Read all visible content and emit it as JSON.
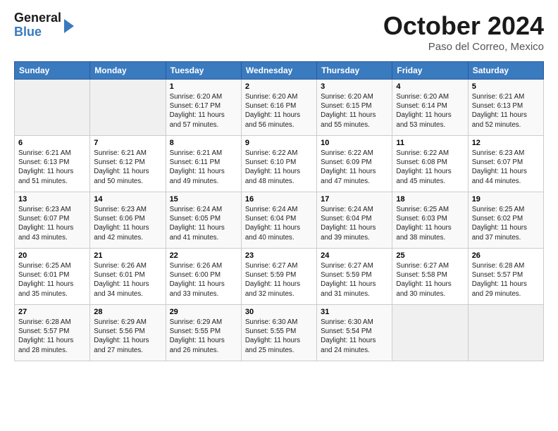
{
  "logo": {
    "line1": "General",
    "line2": "Blue"
  },
  "title": "October 2024",
  "subtitle": "Paso del Correo, Mexico",
  "days_of_week": [
    "Sunday",
    "Monday",
    "Tuesday",
    "Wednesday",
    "Thursday",
    "Friday",
    "Saturday"
  ],
  "weeks": [
    [
      {
        "day": "",
        "info": ""
      },
      {
        "day": "",
        "info": ""
      },
      {
        "day": "1",
        "info": "Sunrise: 6:20 AM\nSunset: 6:17 PM\nDaylight: 11 hours and 57 minutes."
      },
      {
        "day": "2",
        "info": "Sunrise: 6:20 AM\nSunset: 6:16 PM\nDaylight: 11 hours and 56 minutes."
      },
      {
        "day": "3",
        "info": "Sunrise: 6:20 AM\nSunset: 6:15 PM\nDaylight: 11 hours and 55 minutes."
      },
      {
        "day": "4",
        "info": "Sunrise: 6:20 AM\nSunset: 6:14 PM\nDaylight: 11 hours and 53 minutes."
      },
      {
        "day": "5",
        "info": "Sunrise: 6:21 AM\nSunset: 6:13 PM\nDaylight: 11 hours and 52 minutes."
      }
    ],
    [
      {
        "day": "6",
        "info": "Sunrise: 6:21 AM\nSunset: 6:13 PM\nDaylight: 11 hours and 51 minutes."
      },
      {
        "day": "7",
        "info": "Sunrise: 6:21 AM\nSunset: 6:12 PM\nDaylight: 11 hours and 50 minutes."
      },
      {
        "day": "8",
        "info": "Sunrise: 6:21 AM\nSunset: 6:11 PM\nDaylight: 11 hours and 49 minutes."
      },
      {
        "day": "9",
        "info": "Sunrise: 6:22 AM\nSunset: 6:10 PM\nDaylight: 11 hours and 48 minutes."
      },
      {
        "day": "10",
        "info": "Sunrise: 6:22 AM\nSunset: 6:09 PM\nDaylight: 11 hours and 47 minutes."
      },
      {
        "day": "11",
        "info": "Sunrise: 6:22 AM\nSunset: 6:08 PM\nDaylight: 11 hours and 45 minutes."
      },
      {
        "day": "12",
        "info": "Sunrise: 6:23 AM\nSunset: 6:07 PM\nDaylight: 11 hours and 44 minutes."
      }
    ],
    [
      {
        "day": "13",
        "info": "Sunrise: 6:23 AM\nSunset: 6:07 PM\nDaylight: 11 hours and 43 minutes."
      },
      {
        "day": "14",
        "info": "Sunrise: 6:23 AM\nSunset: 6:06 PM\nDaylight: 11 hours and 42 minutes."
      },
      {
        "day": "15",
        "info": "Sunrise: 6:24 AM\nSunset: 6:05 PM\nDaylight: 11 hours and 41 minutes."
      },
      {
        "day": "16",
        "info": "Sunrise: 6:24 AM\nSunset: 6:04 PM\nDaylight: 11 hours and 40 minutes."
      },
      {
        "day": "17",
        "info": "Sunrise: 6:24 AM\nSunset: 6:04 PM\nDaylight: 11 hours and 39 minutes."
      },
      {
        "day": "18",
        "info": "Sunrise: 6:25 AM\nSunset: 6:03 PM\nDaylight: 11 hours and 38 minutes."
      },
      {
        "day": "19",
        "info": "Sunrise: 6:25 AM\nSunset: 6:02 PM\nDaylight: 11 hours and 37 minutes."
      }
    ],
    [
      {
        "day": "20",
        "info": "Sunrise: 6:25 AM\nSunset: 6:01 PM\nDaylight: 11 hours and 35 minutes."
      },
      {
        "day": "21",
        "info": "Sunrise: 6:26 AM\nSunset: 6:01 PM\nDaylight: 11 hours and 34 minutes."
      },
      {
        "day": "22",
        "info": "Sunrise: 6:26 AM\nSunset: 6:00 PM\nDaylight: 11 hours and 33 minutes."
      },
      {
        "day": "23",
        "info": "Sunrise: 6:27 AM\nSunset: 5:59 PM\nDaylight: 11 hours and 32 minutes."
      },
      {
        "day": "24",
        "info": "Sunrise: 6:27 AM\nSunset: 5:59 PM\nDaylight: 11 hours and 31 minutes."
      },
      {
        "day": "25",
        "info": "Sunrise: 6:27 AM\nSunset: 5:58 PM\nDaylight: 11 hours and 30 minutes."
      },
      {
        "day": "26",
        "info": "Sunrise: 6:28 AM\nSunset: 5:57 PM\nDaylight: 11 hours and 29 minutes."
      }
    ],
    [
      {
        "day": "27",
        "info": "Sunrise: 6:28 AM\nSunset: 5:57 PM\nDaylight: 11 hours and 28 minutes."
      },
      {
        "day": "28",
        "info": "Sunrise: 6:29 AM\nSunset: 5:56 PM\nDaylight: 11 hours and 27 minutes."
      },
      {
        "day": "29",
        "info": "Sunrise: 6:29 AM\nSunset: 5:55 PM\nDaylight: 11 hours and 26 minutes."
      },
      {
        "day": "30",
        "info": "Sunrise: 6:30 AM\nSunset: 5:55 PM\nDaylight: 11 hours and 25 minutes."
      },
      {
        "day": "31",
        "info": "Sunrise: 6:30 AM\nSunset: 5:54 PM\nDaylight: 11 hours and 24 minutes."
      },
      {
        "day": "",
        "info": ""
      },
      {
        "day": "",
        "info": ""
      }
    ]
  ]
}
